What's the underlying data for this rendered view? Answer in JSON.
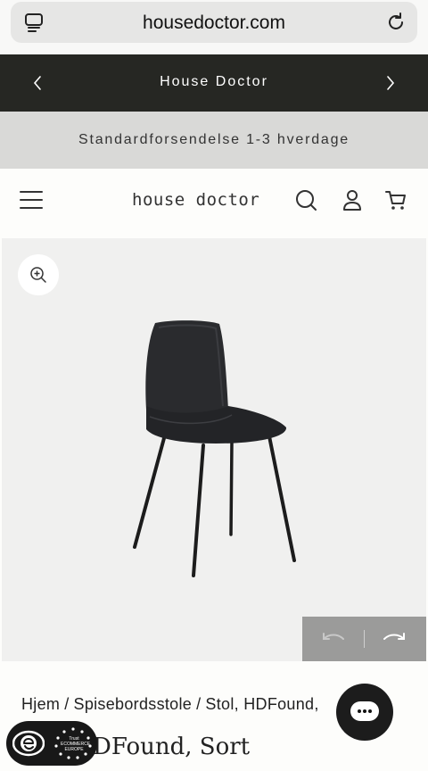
{
  "browser": {
    "url": "housedoctor.com",
    "tabs_icon": "tabs-icon",
    "reload_icon": "reload-icon"
  },
  "announcement": {
    "text": "House Doctor",
    "prev_icon": "chevron-left-icon",
    "next_icon": "chevron-right-icon"
  },
  "shipping": {
    "text": "Standardforsendelse 1-3 hverdage"
  },
  "header": {
    "logo": "house doctor",
    "icons": [
      "menu-icon",
      "search-icon",
      "account-icon",
      "cart-icon"
    ]
  },
  "gallery": {
    "zoom_icon": "zoom-in-icon",
    "image_alt": "Black dining chair",
    "undo_icon": "undo-icon",
    "redo_icon": "redo-icon"
  },
  "breadcrumb": {
    "items": [
      "Hjem",
      "Spisebordsstole",
      "Stol, HDFound, ",
      ""
    ],
    "separator": "/"
  },
  "product": {
    "title": "DFound, Sort"
  },
  "trust_badge": {
    "text": "Trust ECOMMERCE EUROPE"
  },
  "colors": {
    "announcement_bg": "#262723",
    "shipping_bg": "#d9d9d7",
    "gallery_bg": "#f0f0ef",
    "chat_bg": "#1c1c1c"
  }
}
